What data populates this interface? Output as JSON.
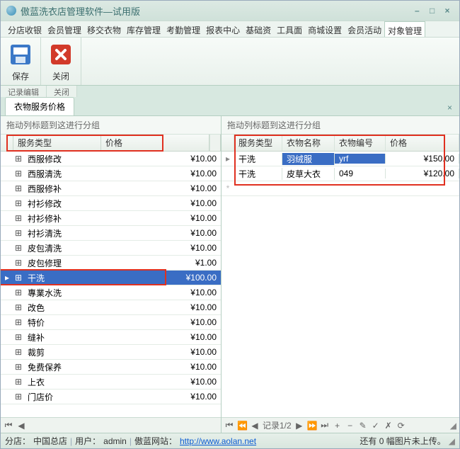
{
  "window": {
    "title": "傲蓝洗衣店管理软件—试用版"
  },
  "menus": [
    "分店收银",
    "会员管理",
    "移交衣物",
    "库存管理",
    "考勤管理",
    "报表中心",
    "基础资",
    "工具面",
    "商城设置",
    "会员活动",
    "对象管理"
  ],
  "active_menu": 10,
  "toolbar": {
    "save": "保存",
    "close": "关闭",
    "groups": [
      "记录编辑",
      "关闭"
    ]
  },
  "tab": {
    "label": "衣物服务价格"
  },
  "group_hint": "拖动列标题到这进行分组",
  "left": {
    "columns": {
      "type": "服务类型",
      "price": "价格"
    },
    "rows": [
      {
        "name": "西服修改",
        "price": "¥10.00"
      },
      {
        "name": "西服清洗",
        "price": "¥10.00"
      },
      {
        "name": "西服修补",
        "price": "¥10.00"
      },
      {
        "name": "衬衫修改",
        "price": "¥10.00"
      },
      {
        "name": "衬衫修补",
        "price": "¥10.00"
      },
      {
        "name": "衬衫清洗",
        "price": "¥10.00"
      },
      {
        "name": "皮包清洗",
        "price": "¥10.00"
      },
      {
        "name": "皮包修理",
        "price": "¥1.00"
      },
      {
        "name": "干洗",
        "price": "¥100.00",
        "selected": true
      },
      {
        "name": "專業水洗",
        "price": "¥10.00"
      },
      {
        "name": "改色",
        "price": "¥10.00"
      },
      {
        "name": "特价",
        "price": "¥10.00"
      },
      {
        "name": "缝补",
        "price": "¥10.00"
      },
      {
        "name": "裁剪",
        "price": "¥10.00"
      },
      {
        "name": "免费保养",
        "price": "¥10.00"
      },
      {
        "name": "上衣",
        "price": "¥10.00"
      },
      {
        "name": "门店价",
        "price": "¥10.00"
      }
    ]
  },
  "right": {
    "columns": {
      "type": "服务类型",
      "item": "衣物名称",
      "code": "衣物编号",
      "price": "价格"
    },
    "rows": [
      {
        "type": "干洗",
        "item": "羽绒服",
        "code": "yrf",
        "price": "¥150.00",
        "selected": true
      },
      {
        "type": "干洗",
        "item": "皮草大衣",
        "code": "049",
        "price": "¥120.00"
      }
    ],
    "nav": {
      "label": "记录1/2"
    }
  },
  "status": {
    "branch_label": "分店：",
    "branch": "中国总店",
    "user_label": "用户：",
    "user": "admin",
    "site_label": "傲蓝网站：",
    "site_url": "http://www.aolan.net",
    "upload": "还有 0 幅图片未上传。"
  }
}
